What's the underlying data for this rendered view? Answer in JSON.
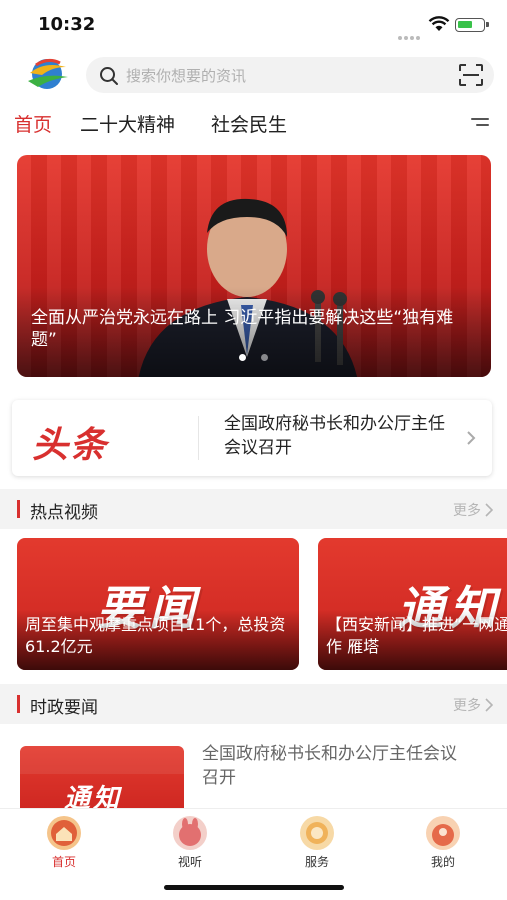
{
  "status_bar": {
    "time": "10:32"
  },
  "search": {
    "placeholder": "搜索你想要的资讯"
  },
  "tabs": [
    {
      "label": "首页",
      "active": true
    },
    {
      "label": "二十大精神",
      "active": false
    },
    {
      "label": "社会民生",
      "active": false
    }
  ],
  "banner": {
    "caption": "全面从严治党永远在路上 习近平指出要解决这些“独有难题”",
    "pages": 2,
    "current_page": 1
  },
  "headline": {
    "tag": "头条",
    "text": "全国政府秘书长和办公厅主任会议召开"
  },
  "sections": {
    "video": {
      "title": "热点视频",
      "more": "更多"
    },
    "politics": {
      "title": "时政要闻",
      "more": "更多"
    }
  },
  "video_cards": [
    {
      "big": "要闻",
      "caption": "周至集中观摩重点项目11个，总投资61.2亿元"
    },
    {
      "big": "通知",
      "caption": "【西安新闻】推进“一网通一落地”工作 雁塔"
    }
  ],
  "news_items": [
    {
      "thumb": "通知",
      "title": "全国政府秘书长和办公厅主任会议召开"
    }
  ],
  "bottom_nav": [
    {
      "label": "首页",
      "active": true,
      "icon": "home-icon"
    },
    {
      "label": "视听",
      "active": false,
      "icon": "media-icon"
    },
    {
      "label": "服务",
      "active": false,
      "icon": "service-icon"
    },
    {
      "label": "我的",
      "active": false,
      "icon": "profile-icon"
    }
  ],
  "colors": {
    "accent": "#d8302f",
    "banner_red": "#c8201c",
    "section_bg": "#f3f3f3"
  }
}
